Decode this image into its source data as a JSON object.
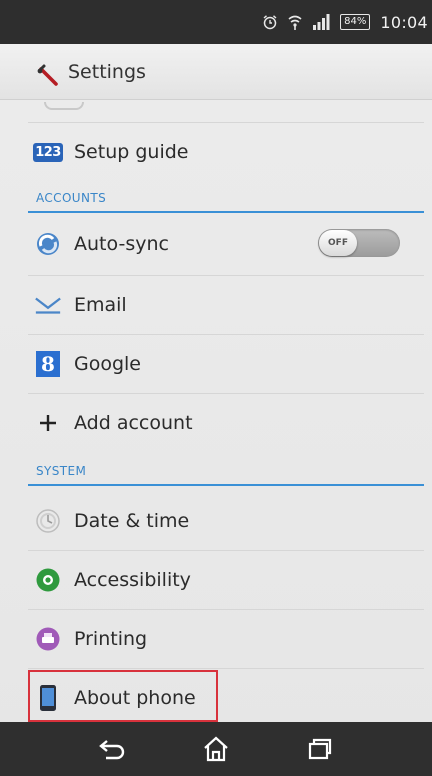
{
  "status_bar": {
    "battery": "84%",
    "time": "10:04"
  },
  "action_bar": {
    "title": "Settings"
  },
  "rows": {
    "setup_guide": {
      "label": "Setup guide",
      "icon_text": "123"
    },
    "auto_sync": {
      "label": "Auto-sync",
      "toggle_state": "OFF"
    },
    "email": {
      "label": "Email"
    },
    "google": {
      "label": "Google",
      "icon_text": "8"
    },
    "add_account": {
      "label": "Add account"
    },
    "date_time": {
      "label": "Date & time"
    },
    "accessibility": {
      "label": "Accessibility"
    },
    "printing": {
      "label": "Printing"
    },
    "about_phone": {
      "label": "About phone"
    }
  },
  "sections": {
    "accounts": "ACCOUNTS",
    "system": "SYSTEM"
  },
  "colors": {
    "section_accent": "#3a90d6",
    "highlight": "#d8323c",
    "google_blue": "#2b6fd0",
    "accessibility_green": "#2f9a3e",
    "printing_purple": "#a05ab8"
  },
  "icons": {
    "nav": [
      "back-icon",
      "home-icon",
      "recent-apps-icon"
    ]
  }
}
